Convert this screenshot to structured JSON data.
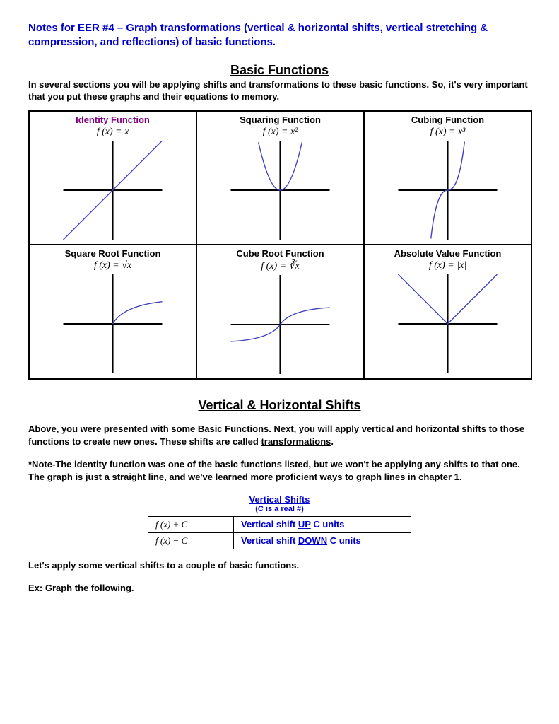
{
  "header": "Notes for EER #4 – Graph transformations (vertical & horizontal shifts, vertical stretching & compression, and reflections) of basic functions.",
  "section1": {
    "heading": "Basic Functions",
    "intro": "In several sections you will be applying shifts and transformations to these basic functions. So, it's very important that you put these graphs and their equations to memory."
  },
  "functions": {
    "r0c0": {
      "title": "Identity Function",
      "eq": "f (x) = x"
    },
    "r0c1": {
      "title": "Squaring Function",
      "eq": "f (x) = x²"
    },
    "r0c2": {
      "title": "Cubing Function",
      "eq": "f (x) = x³"
    },
    "r1c0": {
      "title": "Square Root Function",
      "eq": "f (x) = √x"
    },
    "r1c1": {
      "title": "Cube Root Function",
      "eq": "f (x) = ∛x"
    },
    "r1c2": {
      "title": "Absolute Value Function",
      "eq": "f (x) = |x|"
    }
  },
  "section2": {
    "heading": "Vertical & Horizontal Shifts",
    "para1a": "Above, you were presented with some Basic Functions.  Next, you will apply vertical and horizontal shifts to those functions to create new ones.  These shifts are called ",
    "para1b": "transformations",
    "para1c": ".",
    "para2": "*Note-The identity function was one of the basic functions listed, but we won't be applying any shifts to that one.  The graph is just a straight line, and we've learned more proficient ways to graph lines in chapter 1.",
    "vshift_heading": "Vertical Shifts",
    "vshift_sub": "(C is a real #)",
    "table": {
      "r0": {
        "eq": "f (x) + C",
        "desc_pre": "Vertical shift ",
        "desc_key": "UP",
        "desc_post": " C units"
      },
      "r1": {
        "eq": "f (x) − C",
        "desc_pre": "Vertical shift ",
        "desc_key": "DOWN",
        "desc_post": " C units"
      }
    },
    "para3": "Let's apply some vertical shifts to a couple of basic functions.",
    "para4": "Ex:  Graph the following."
  },
  "chart_data": [
    {
      "type": "line",
      "title": "Identity Function",
      "equation": "f(x)=x",
      "x": [
        -5,
        5
      ],
      "y": [
        -5,
        5
      ],
      "xlim": [
        -5,
        5
      ],
      "ylim": [
        -5,
        5
      ]
    },
    {
      "type": "line",
      "title": "Squaring Function",
      "equation": "f(x)=x^2",
      "x": [
        -2.2,
        -1,
        0,
        1,
        2.2
      ],
      "y": [
        4.84,
        1,
        0,
        1,
        4.84
      ],
      "xlim": [
        -5,
        5
      ],
      "ylim": [
        -5,
        5
      ]
    },
    {
      "type": "line",
      "title": "Cubing Function",
      "equation": "f(x)=x^3",
      "x": [
        -1.7,
        -1,
        0,
        1,
        1.7
      ],
      "y": [
        -4.9,
        -1,
        0,
        1,
        4.9
      ],
      "xlim": [
        -5,
        5
      ],
      "ylim": [
        -5,
        5
      ]
    },
    {
      "type": "line",
      "title": "Square Root Function",
      "equation": "f(x)=sqrt(x)",
      "x": [
        0,
        1,
        4,
        5
      ],
      "y": [
        0,
        1,
        2,
        2.24
      ],
      "xlim": [
        -5,
        5
      ],
      "ylim": [
        -5,
        5
      ]
    },
    {
      "type": "line",
      "title": "Cube Root Function",
      "equation": "f(x)=cbrt(x)",
      "x": [
        -5,
        -1,
        0,
        1,
        5
      ],
      "y": [
        -1.71,
        -1,
        0,
        1,
        1.71
      ],
      "xlim": [
        -5,
        5
      ],
      "ylim": [
        -5,
        5
      ]
    },
    {
      "type": "line",
      "title": "Absolute Value Function",
      "equation": "f(x)=|x|",
      "x": [
        -5,
        0,
        5
      ],
      "y": [
        5,
        0,
        5
      ],
      "xlim": [
        -5,
        5
      ],
      "ylim": [
        -5,
        5
      ]
    }
  ]
}
